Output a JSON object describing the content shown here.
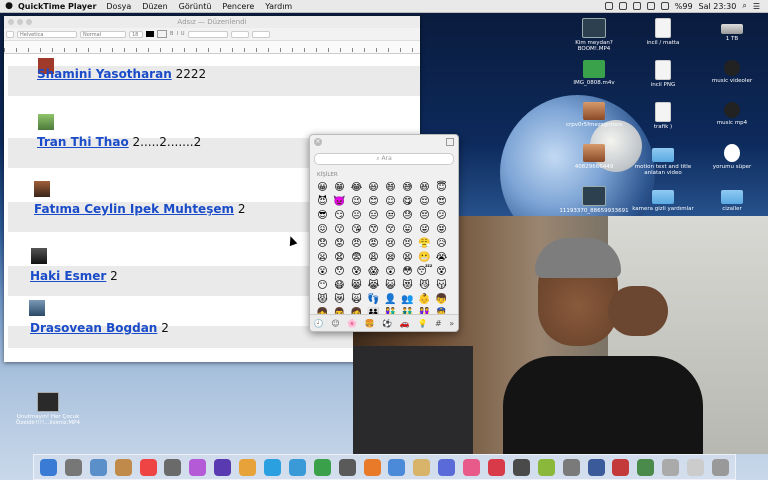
{
  "menubar": {
    "apple": "",
    "app_name": "QuickTime Player",
    "items": [
      "Dosya",
      "Düzen",
      "Görüntü",
      "Pencere",
      "Yardım"
    ],
    "battery": "%99",
    "clock": "Sal 23:30"
  },
  "editor": {
    "title": "Adsız — Düzenlendi",
    "font_family": "Helvetica",
    "font_style": "Normal",
    "font_size": "18",
    "entries": [
      {
        "name": "Shamini Yasotharan",
        "suffix": "2222"
      },
      {
        "name": "Tran Thi Thao",
        "suffix": "2.....2.......2"
      },
      {
        "name": "Fatıma Ceylin Ipek Muhteşem",
        "suffix": "2"
      },
      {
        "name": "Haki Esmer",
        "suffix": "2"
      },
      {
        "name": "Drasovean Bogdan",
        "suffix": "2"
      }
    ]
  },
  "emoji_picker": {
    "search_placeholder": "Ara",
    "category": "KİŞİLER",
    "emojis": [
      "😀",
      "😁",
      "😂",
      "😃",
      "😄",
      "😅",
      "😆",
      "😇",
      "😈",
      "👿",
      "😉",
      "😊",
      "☺",
      "😋",
      "😌",
      "😍",
      "😎",
      "😏",
      "😐",
      "😑",
      "😒",
      "😓",
      "😔",
      "😕",
      "😖",
      "😗",
      "😘",
      "😙",
      "😚",
      "😛",
      "😜",
      "😝",
      "😞",
      "😟",
      "😠",
      "😡",
      "😢",
      "😣",
      "😤",
      "😥",
      "😦",
      "😧",
      "😨",
      "😩",
      "😪",
      "😫",
      "😬",
      "😭",
      "😮",
      "😯",
      "😰",
      "😱",
      "😲",
      "😳",
      "😴",
      "😵",
      "😶",
      "😷",
      "😸",
      "😹",
      "😺",
      "😻",
      "😼",
      "😽",
      "😾",
      "😿",
      "🙀",
      "👣",
      "👤",
      "👥",
      "👶",
      "👦",
      "👧",
      "👨",
      "👩",
      "👪",
      "👫",
      "👬",
      "👭",
      "👮",
      "👯",
      "👰"
    ],
    "tabs": [
      "🕘",
      "☺",
      "🌸",
      "🍔",
      "⚽",
      "🚗",
      "💡",
      "#",
      "»"
    ]
  },
  "desktop_icons": [
    {
      "label": "Kim meydan? BOOM!.MP4",
      "kind": "video"
    },
    {
      "label": "incil / matta",
      "kind": "file"
    },
    {
      "label": "1 TB",
      "kind": "hdd"
    },
    {
      "label": "IMG_0808.m4v",
      "kind": "green"
    },
    {
      "label": "incil PNG",
      "kind": "file"
    },
    {
      "label": "music videoler",
      "kind": "music"
    },
    {
      "label": "crpv0r5fmezsgnfovs",
      "kind": "photo"
    },
    {
      "label": "trafik )",
      "kind": "file"
    },
    {
      "label": "music mp4",
      "kind": "music"
    },
    {
      "label": "40829666449",
      "kind": "photo"
    },
    {
      "label": "motion text and title anlatan video",
      "kind": "folder"
    },
    {
      "label": "yorumu süper",
      "kind": "hand"
    },
    {
      "label": "11193370_88659933691",
      "kind": "video"
    },
    {
      "label": "kamera gizli yardımlar",
      "kind": "folder"
    },
    {
      "label": "cizaller",
      "kind": "folder"
    }
  ],
  "bottom_file": {
    "label": "Unutmayın! Her Çocuk Özeldir!!!!...lisimiz.MP4"
  }
}
